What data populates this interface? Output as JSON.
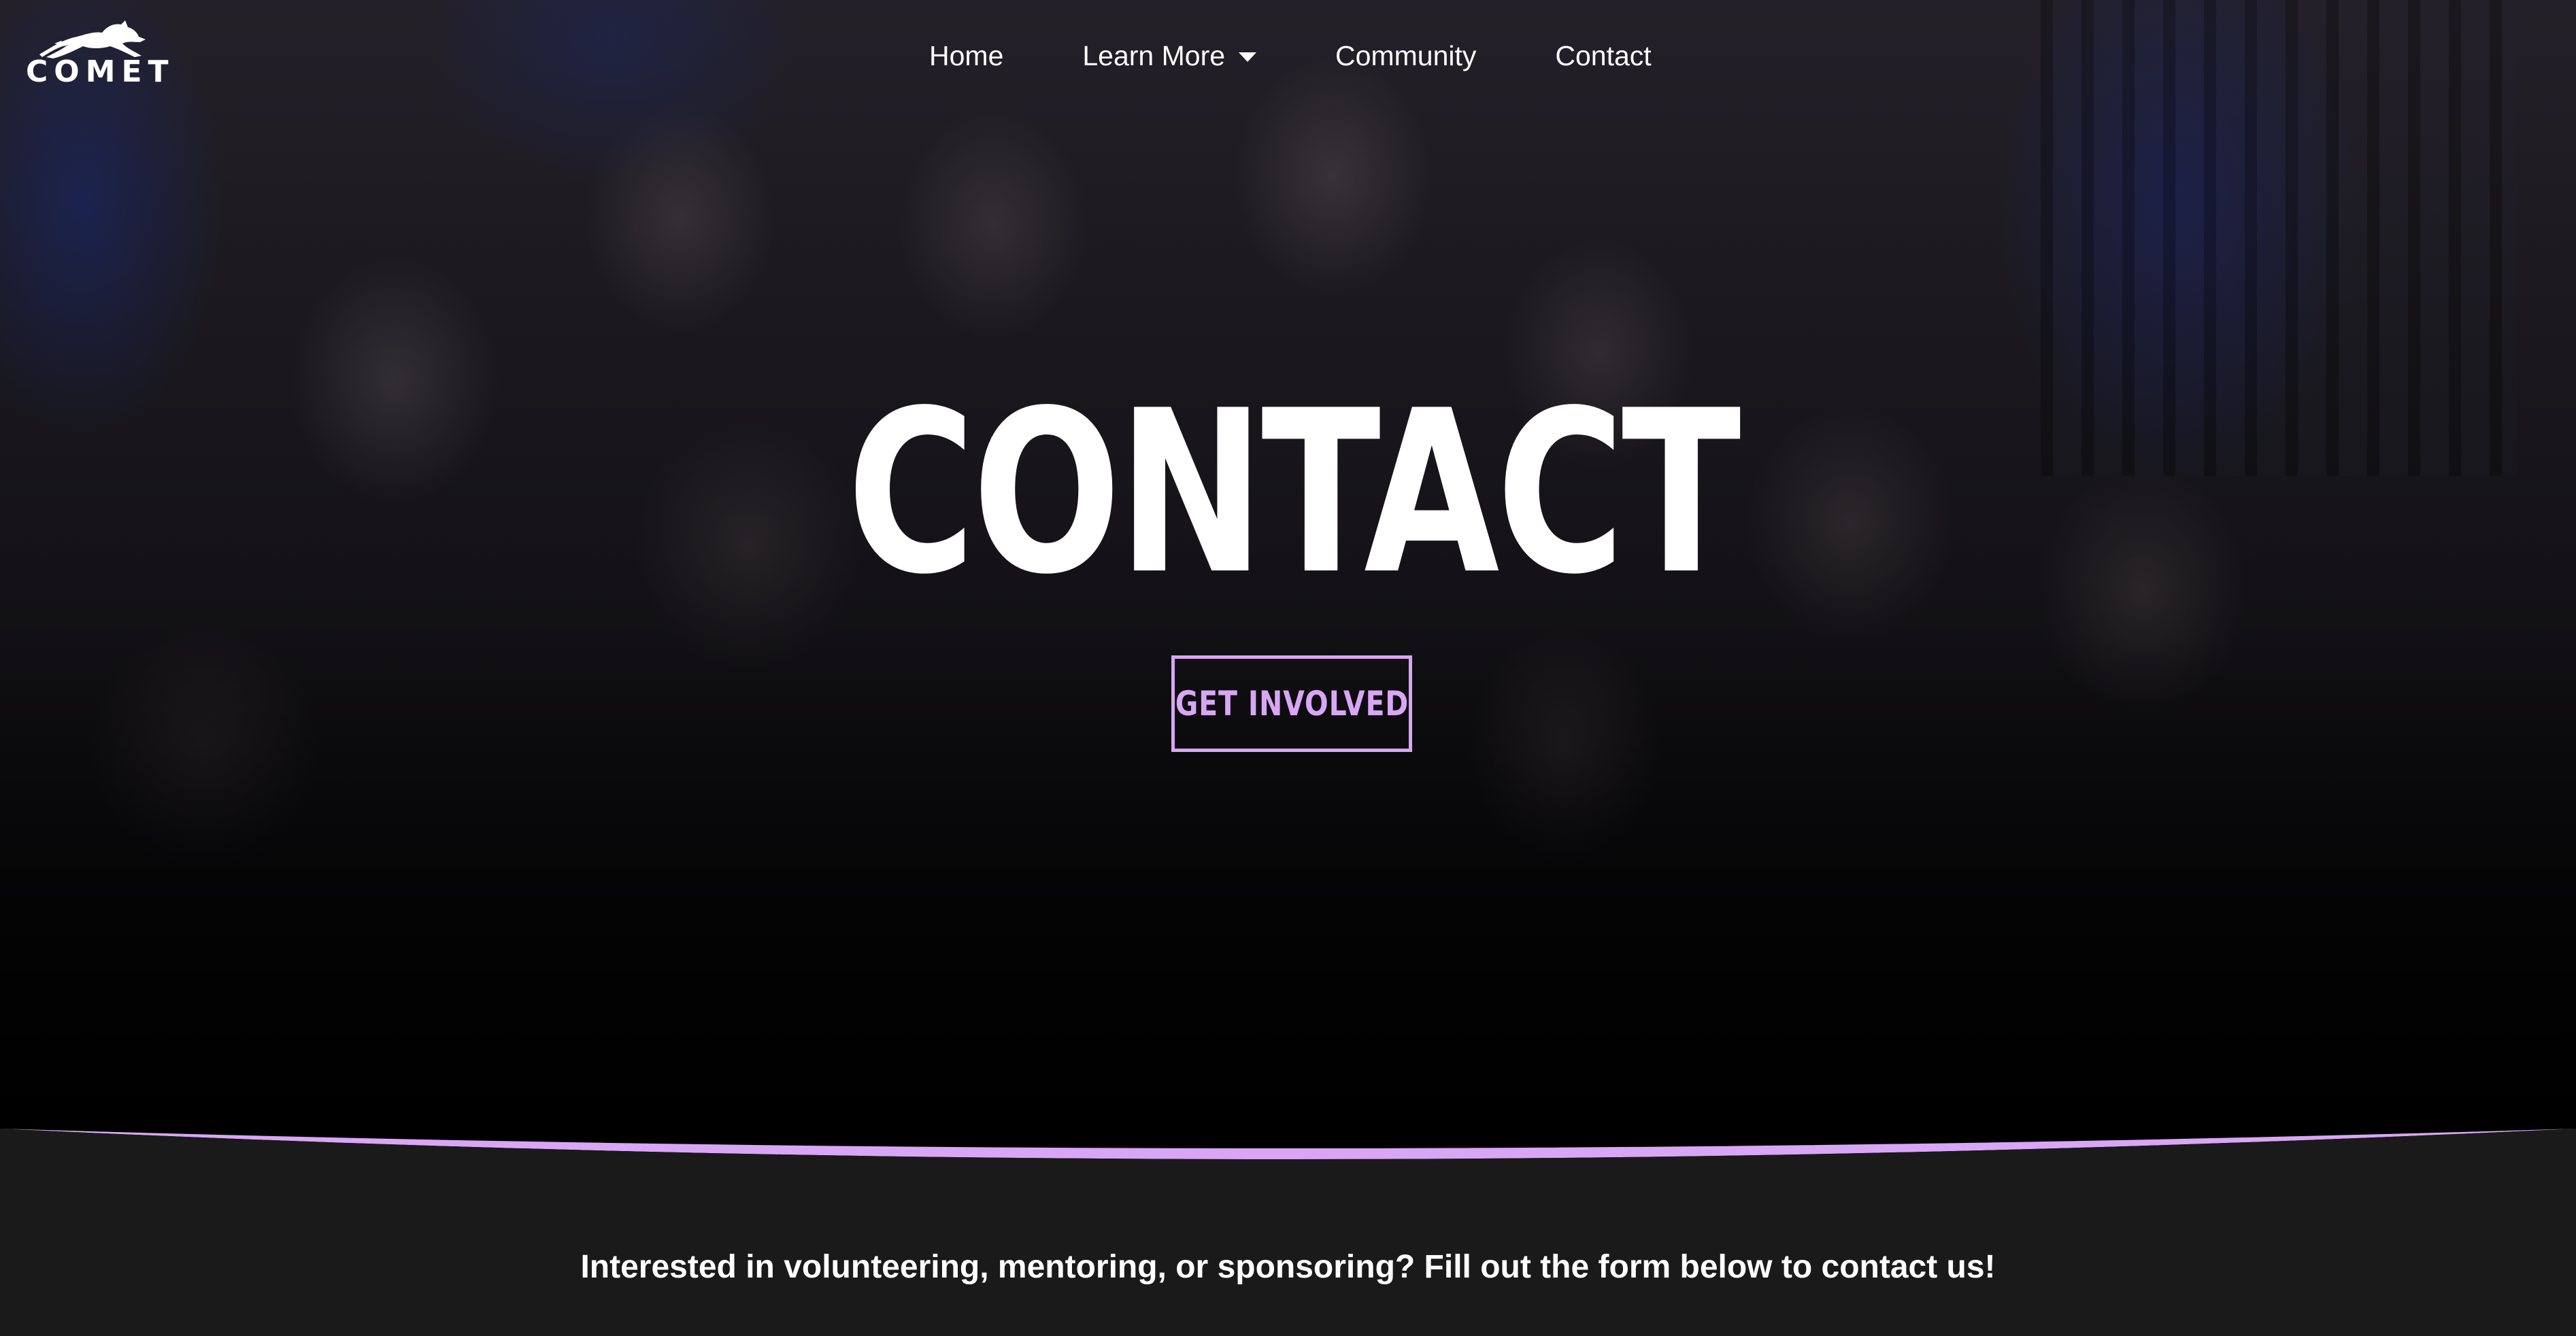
{
  "brand": {
    "logo_text": "COMET"
  },
  "nav": {
    "items": [
      {
        "label": "Home"
      },
      {
        "label": "Learn More"
      },
      {
        "label": "Community"
      },
      {
        "label": "Contact"
      }
    ]
  },
  "hero": {
    "title": "CONTACT",
    "cta_label": "GET INVOLVED"
  },
  "intro": {
    "text": "Interested in volunteering, mentoring, or sponsoring? Fill out the form below to contact us!"
  },
  "colors": {
    "accent": "#d9a6f5",
    "section_background": "#1a1a1a",
    "text": "#ffffff"
  },
  "icons": {
    "logo_mark": "leaping-cat-icon",
    "dropdown": "caret-down-icon"
  }
}
